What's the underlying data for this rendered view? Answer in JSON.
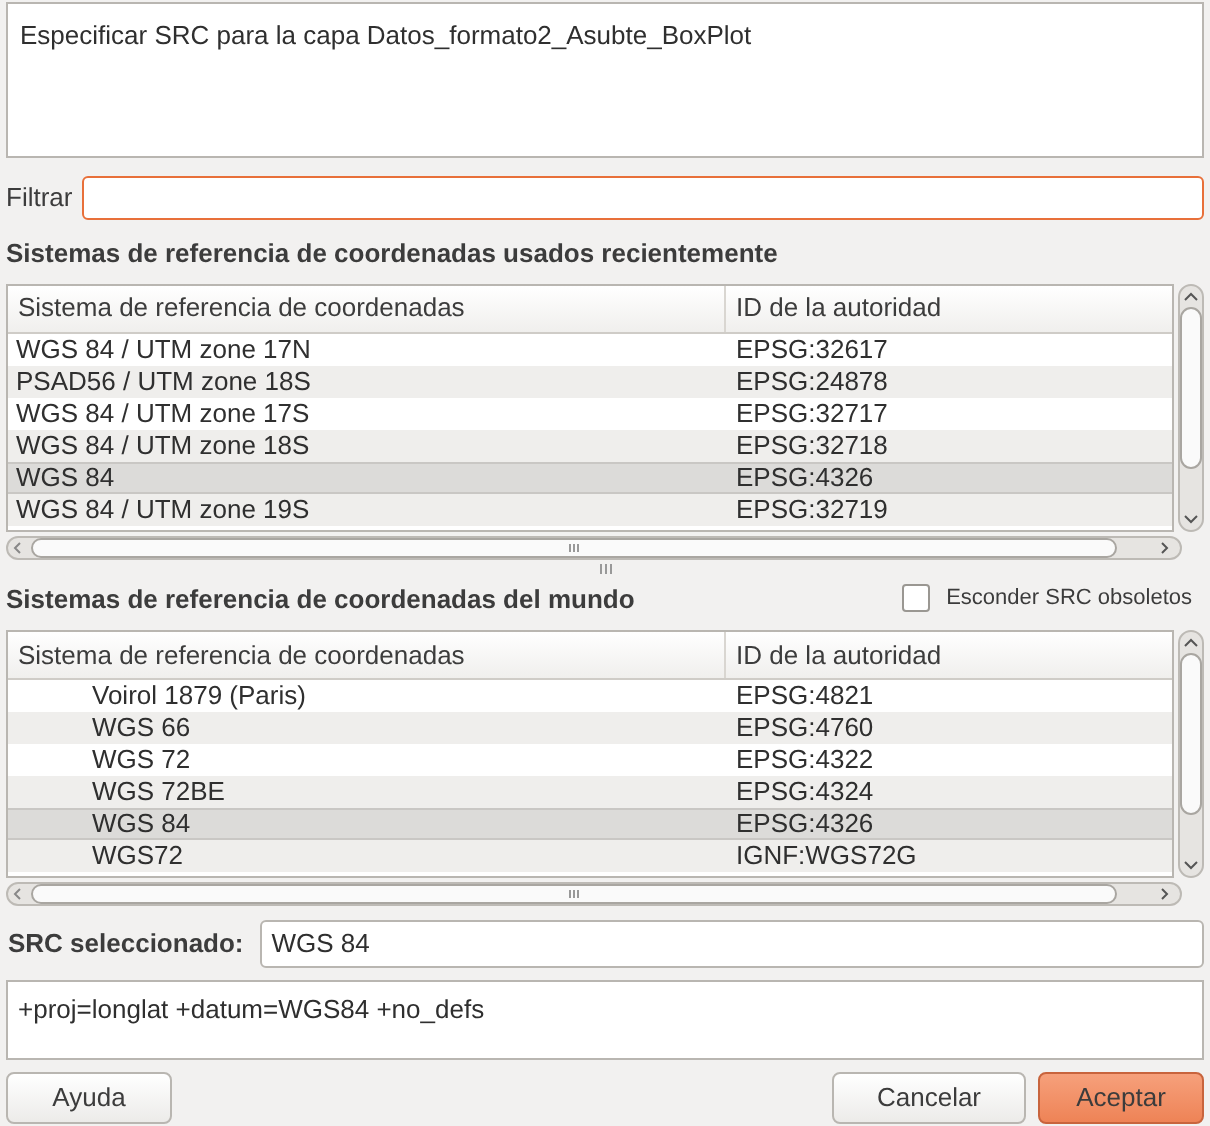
{
  "description": "Especificar SRC para la capa Datos_formato2_Asubte_BoxPlot",
  "filter": {
    "label": "Filtrar"
  },
  "recent": {
    "title": "Sistemas de referencia de coordenadas usados recientemente",
    "columns": [
      "Sistema de referencia de coordenadas",
      "ID de la autoridad"
    ],
    "rows": [
      {
        "name": "WGS 84 / UTM zone 17N",
        "id": "EPSG:32617",
        "selected": false
      },
      {
        "name": "PSAD56 / UTM zone 18S",
        "id": "EPSG:24878",
        "selected": false
      },
      {
        "name": "WGS 84 / UTM zone 17S",
        "id": "EPSG:32717",
        "selected": false
      },
      {
        "name": "WGS 84 / UTM zone 18S",
        "id": "EPSG:32718",
        "selected": false
      },
      {
        "name": "WGS 84",
        "id": "EPSG:4326",
        "selected": true
      },
      {
        "name": "WGS 84 / UTM zone 19S",
        "id": "EPSG:32719",
        "selected": false
      }
    ]
  },
  "world": {
    "title": "Sistemas de referencia de coordenadas del mundo",
    "hide_deprecated": {
      "label": "Esconder SRC obsoletos",
      "checked": false
    },
    "columns": [
      "Sistema de referencia de coordenadas",
      "ID de la autoridad"
    ],
    "rows": [
      {
        "name": "Voirol 1879 (Paris)",
        "id": "EPSG:4821",
        "selected": false
      },
      {
        "name": "WGS 66",
        "id": "EPSG:4760",
        "selected": false
      },
      {
        "name": "WGS 72",
        "id": "EPSG:4322",
        "selected": false
      },
      {
        "name": "WGS 72BE",
        "id": "EPSG:4324",
        "selected": false
      },
      {
        "name": "WGS 84",
        "id": "EPSG:4326",
        "selected": true
      },
      {
        "name": "WGS72",
        "id": "IGNF:WGS72G",
        "selected": false
      }
    ]
  },
  "selected_crs": {
    "label": "SRC seleccionado:",
    "value": "WGS 84"
  },
  "proj_definition": "+proj=longlat +datum=WGS84 +no_defs",
  "buttons": [
    {
      "label": "Ayuda",
      "kind": "normal"
    },
    {
      "label": "Cancelar",
      "kind": "normal"
    },
    {
      "label": "Aceptar",
      "kind": "default"
    }
  ]
}
